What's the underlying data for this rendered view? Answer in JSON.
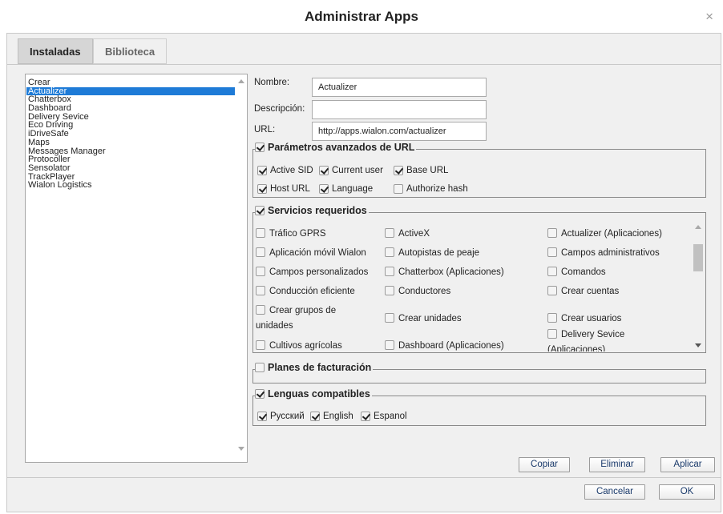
{
  "dialog": {
    "title": "Administrar Apps",
    "close_glyph": "×"
  },
  "tabs": [
    {
      "label": "Instaladas",
      "active": true
    },
    {
      "label": "Biblioteca",
      "active": false
    }
  ],
  "app_list": {
    "selected": "Actualizer",
    "items": [
      "Crear",
      "Actualizer",
      "Chatterbox",
      "Dashboard",
      "Delivery Sevice",
      "Eco Driving",
      "iDriveSafe",
      "Maps",
      "Messages Manager",
      "Protocoller",
      "Sensolator",
      "TrackPlayer",
      "Wialon Logistics"
    ]
  },
  "form": {
    "name_label": "Nombre:",
    "name_value": "Actualizer",
    "description_label": "Descripción:",
    "description_value": "",
    "url_label": "URL:",
    "url_value": "http://apps.wialon.com/actualizer"
  },
  "advanced_url": {
    "legend": "Parámetros avanzados de URL",
    "checked": true,
    "options": [
      {
        "label": "Active SID",
        "checked": true
      },
      {
        "label": "Current user",
        "checked": true
      },
      {
        "label": "Base URL",
        "checked": true
      },
      {
        "label": "Host URL",
        "checked": true
      },
      {
        "label": "Language",
        "checked": true
      },
      {
        "label": "Authorize hash",
        "checked": false
      }
    ]
  },
  "services": {
    "legend": "Servicios requeridos",
    "checked": true,
    "items": [
      {
        "label": "Tráfico GPRS",
        "checked": false
      },
      {
        "label": "ActiveX",
        "checked": false
      },
      {
        "label": "Actualizer (Aplicaciones)",
        "checked": false
      },
      {
        "label": "Aplicación móvil Wialon",
        "checked": false
      },
      {
        "label": "Autopistas de peaje",
        "checked": false
      },
      {
        "label": "Campos administrativos",
        "checked": false
      },
      {
        "label": "Campos personalizados",
        "checked": false
      },
      {
        "label": "Chatterbox (Aplicaciones)",
        "checked": false
      },
      {
        "label": "Comandos",
        "checked": false
      },
      {
        "label": "Conducción eficiente",
        "checked": false
      },
      {
        "label": "Conductores",
        "checked": false
      },
      {
        "label": "Crear cuentas",
        "checked": false
      },
      {
        "label": "Crear grupos de unidades",
        "checked": false
      },
      {
        "label": "Crear unidades",
        "checked": false
      },
      {
        "label": "Crear usuarios",
        "checked": false
      },
      {
        "label": "Cultivos agrícolas",
        "checked": false
      },
      {
        "label": "Dashboard (Aplicaciones)",
        "checked": false
      },
      {
        "label": "Delivery Sevice (Aplicaciones)",
        "checked": false
      }
    ]
  },
  "billing": {
    "legend": "Planes de facturación",
    "checked": false
  },
  "languages": {
    "legend": "Lenguas compatibles",
    "checked": true,
    "options": [
      {
        "label": "Русский",
        "checked": true
      },
      {
        "label": "English",
        "checked": true
      },
      {
        "label": "Espanol",
        "checked": true
      }
    ]
  },
  "buttons": {
    "copy": "Copiar",
    "delete": "Eliminar",
    "apply": "Aplicar",
    "cancel": "Cancelar",
    "ok": "OK"
  }
}
